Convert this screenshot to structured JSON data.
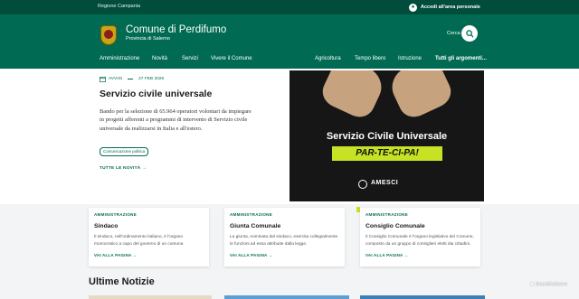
{
  "topbar": {
    "region": "Regione Campania",
    "login": "Accedi all'area personale"
  },
  "header": {
    "title": "Comune di Perdifumo",
    "subtitle": "Provincia di Salerno",
    "search_label": "Cerca"
  },
  "nav": {
    "left": [
      "Amministrazione",
      "Novità",
      "Servizi",
      "Vivere il Comune"
    ],
    "right": [
      "Agricoltura",
      "Tempo libero",
      "Istruzione"
    ],
    "all_topics": "Tutti gli argomenti..."
  },
  "featured": {
    "category": "AVVISI",
    "date": "27 FEB 2026",
    "title": "Servizio civile universale",
    "body": "Bando per la selezione di 65.964 operatori volontari da impiegare in progetti afferenti a programmi di intervento di Servizio civile universale da realizzarsi in Italia e all'estero.",
    "tag": "Comunicazione politica",
    "link": "TUTTE LE NOVITÀ"
  },
  "poster": {
    "title": "Servizio Civile Universale",
    "band": "PAR-TE-CI-PA!",
    "logo": "AMESCI"
  },
  "cards": [
    {
      "category": "AMMINISTRAZIONE",
      "title": "Sindaco",
      "desc": "Il sindaco, nell'ordinamento italiano, è l'organo monocratico a capo del governo di un comune.",
      "link": "VAI ALLA PAGINA"
    },
    {
      "category": "AMMINISTRAZIONE",
      "title": "Giunta Comunale",
      "desc": "La giunta, nominata dal sindaco, esercita collegialmente le funzioni ad essa attribuite dalla legge.",
      "link": "VAI ALLA PAGINA"
    },
    {
      "category": "AMMINISTRAZIONE",
      "title": "Consiglio Comunale",
      "desc": "Il Consiglio Comunale è l'organo legislativo del Comune, composto da un gruppo di consiglieri eletti dai cittadini.",
      "link": "VAI ALLA PAGINA"
    }
  ],
  "news_section": {
    "title": "Ultime Notizie"
  },
  "watermark": {
    "text": "ScanMalware"
  },
  "colors": {
    "primary": "#006b52",
    "topbar": "#004d3b",
    "accent": "#c7e224"
  }
}
